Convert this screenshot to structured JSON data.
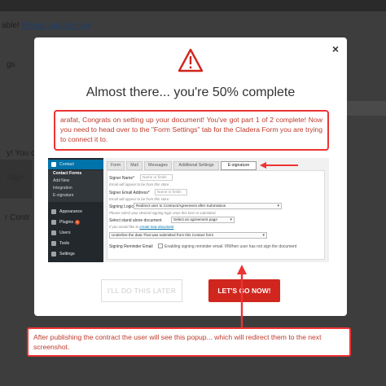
{
  "background": {
    "top_text": "able! ",
    "top_link": "Please update now",
    "frag_1": "gs",
    "frag_2": "y! You c",
    "frag_3": "Sign",
    "frag_4": "r Contr"
  },
  "modal": {
    "close": "×",
    "title": "Almost there... you're 50% complete",
    "message": "arafat, Congrats on setting up your document! You've got part 1 of 2 complete! Now you need to head over to the \"Form Settings\" tab for the Cladera Form you are trying to connect it to.",
    "later_button": "I'LL DO THIS LATER",
    "go_button": "LET'S GO NOW!"
  },
  "screenshot": {
    "sidebar": {
      "contact": "Contact",
      "contact_forms": "Contact Forms",
      "add_new": "Add New",
      "integration": "Integration",
      "esignature": "E-signature",
      "appearance": "Appearance",
      "plugins": "Plugins",
      "plugins_badge": "6",
      "users": "Users",
      "tools": "Tools",
      "settings": "Settings"
    },
    "tabs": [
      "Form",
      "Mail",
      "Messages",
      "Additional Settings",
      "E-signature"
    ],
    "form": {
      "signer_name_label": "Signer Name*",
      "signer_name_placeholder": "Name or fields",
      "signer_name_help": "Email will appear to be from this store.",
      "signer_email_label": "Signer Email Address*",
      "signer_email_placeholder": "Name or fields",
      "signer_email_help": "Email will appear to be from this store.",
      "signing_logic_label": "Signing Logic",
      "signing_logic_value": "Redirect user to Contract/Agreement after Submission",
      "signing_logic_help": "Please select your desired signing logic once this form is submitted.",
      "select_doc_label": "Select stand alone document",
      "select_doc_value": "Select an agreement page",
      "select_doc_help": "If you would like to",
      "select_doc_link": "create new document",
      "underline_value": "Underline the data That was submitted from this Contact form",
      "reminder_label": "Signing Reminder Email",
      "reminder_text": "Enabling signing reminder email. If/When user has not sign the document"
    }
  },
  "annotation": {
    "text": "After publishing the contract the user will see this popup... which will redirect them to the next screenshot."
  },
  "colors": {
    "accent_red": "#d0261e",
    "wp_blue": "#0073aa",
    "wp_dark": "#23282d"
  }
}
